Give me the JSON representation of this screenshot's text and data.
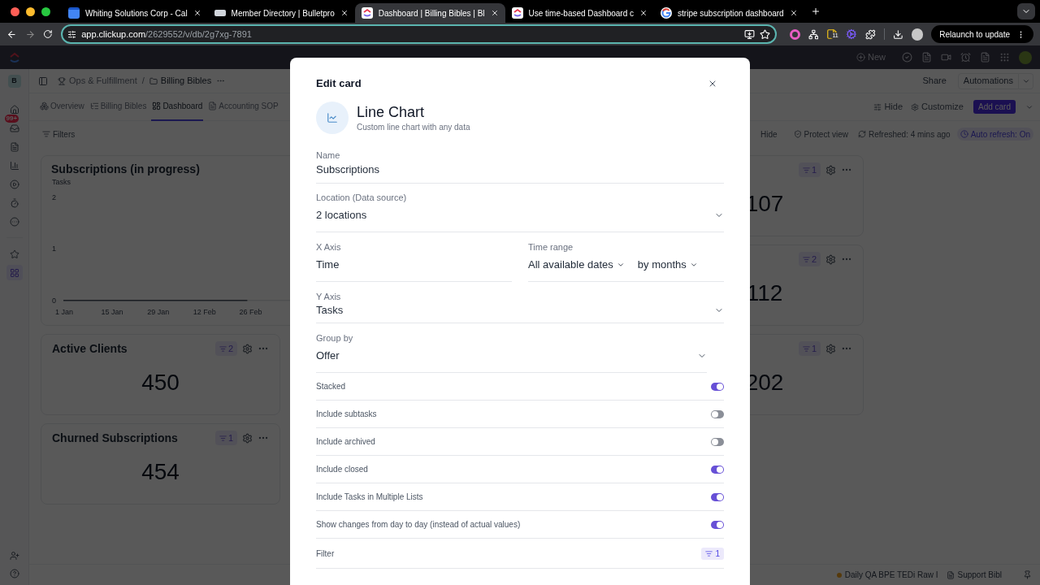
{
  "browser": {
    "tabs": [
      {
        "title": "Whiting Solutions Corp - Cal",
        "selected": false
      },
      {
        "title": "Member Directory | Bulletpro",
        "selected": false
      },
      {
        "title": "Dashboard | Billing Bibles | Bl",
        "selected": true
      },
      {
        "title": "Use time-based Dashboard c",
        "selected": false
      },
      {
        "title": "stripe subscription dashboard",
        "selected": false
      }
    ],
    "url": {
      "host": "app.clickup.com",
      "path": "/2629552/v/db/2g7xg-7891"
    },
    "extension_badge": "11",
    "relaunch": "Relaunch to update"
  },
  "app": {
    "new_button": "New",
    "workspace": "B",
    "breadcrumb": [
      "Ops & Fulfillment",
      "Billing Bibles"
    ],
    "breadcrumb_separator": "/",
    "share": "Share",
    "automations": "Automations",
    "sidebar": {
      "items": [
        {
          "kind": "home",
          "selected": false
        },
        {
          "kind": "inbox",
          "selected": false,
          "badge": "99+"
        },
        {
          "kind": "docs",
          "selected": false
        },
        {
          "kind": "dashboards",
          "selected": false
        },
        {
          "kind": "clips",
          "selected": false
        },
        {
          "kind": "timesheets",
          "selected": false
        },
        {
          "kind": "more",
          "selected": false
        },
        {
          "kind": "favorites",
          "selected": false
        },
        {
          "kind": "spaces",
          "selected": true
        }
      ]
    },
    "view_tabs": [
      {
        "label": "Overview",
        "selected": false
      },
      {
        "label": "Billing Bibles",
        "selected": false
      },
      {
        "label": "Dashboard",
        "selected": true
      },
      {
        "label": "Accounting SOP",
        "selected": false
      }
    ],
    "view_actions": {
      "hide": "Hide",
      "customize": "Customize",
      "add_card": "Add card"
    },
    "filter_bar": {
      "filters": "Filters",
      "hide": "Hide",
      "protect": "Protect view",
      "refreshed": "Refreshed: 4 mins ago",
      "auto_refresh": "Auto refresh: On"
    },
    "left_cards": [
      {
        "kind": "chart",
        "title": "Subscriptions (in progress)",
        "chart_data": {
          "type": "line",
          "ylabel": "Tasks",
          "categories": [
            "1 Jan",
            "15 Jan",
            "29 Jan",
            "12 Feb",
            "26 Feb"
          ],
          "yticks": [
            0,
            1,
            2
          ],
          "ylim": [
            0,
            2.8
          ],
          "series": [
            {
              "color": "#4b5563",
              "values": [
                0,
                0,
                0,
                0,
                0
              ]
            }
          ]
        }
      },
      {
        "kind": "number",
        "title": "Active Clients",
        "filter_count": "2",
        "value": "450"
      },
      {
        "kind": "number",
        "title": "Churned Subscriptions",
        "filter_count": "1",
        "value": "454"
      }
    ],
    "right_cards": [
      {
        "kind": "number",
        "filter_count": "1",
        "value": "107"
      },
      {
        "kind": "number",
        "filter_count": "2",
        "value": "112"
      },
      {
        "kind": "number",
        "filter_count": "1",
        "value": "202"
      }
    ],
    "footer": [
      "Daily QA BPE TEDi Raw I",
      "Support Bibl"
    ]
  },
  "modal": {
    "title": "Edit card",
    "chart_type": {
      "name": "Line Chart",
      "description": "Custom line chart with any data"
    },
    "name": {
      "label": "Name",
      "value": "Subscriptions"
    },
    "location": {
      "label": "Location (Data source)",
      "value": "2 locations"
    },
    "x_axis": {
      "label": "X Axis",
      "value": "Time"
    },
    "time_range": {
      "label": "Time range",
      "range": "All available dates",
      "interval": "by months"
    },
    "y_axis": {
      "label": "Y Axis",
      "value": "Tasks"
    },
    "group_by": {
      "label": "Group by",
      "value": "Offer"
    },
    "toggles": [
      {
        "label": "Stacked",
        "on": true
      },
      {
        "label": "Include subtasks",
        "on": false
      },
      {
        "label": "Include archived",
        "on": false
      },
      {
        "label": "Include closed",
        "on": true
      },
      {
        "label": "Include Tasks in Multiple Lists",
        "on": true
      },
      {
        "label": "Show changes from day to day (instead of actual values)",
        "on": true
      }
    ],
    "filter": {
      "label": "Filter",
      "count": "1"
    }
  }
}
